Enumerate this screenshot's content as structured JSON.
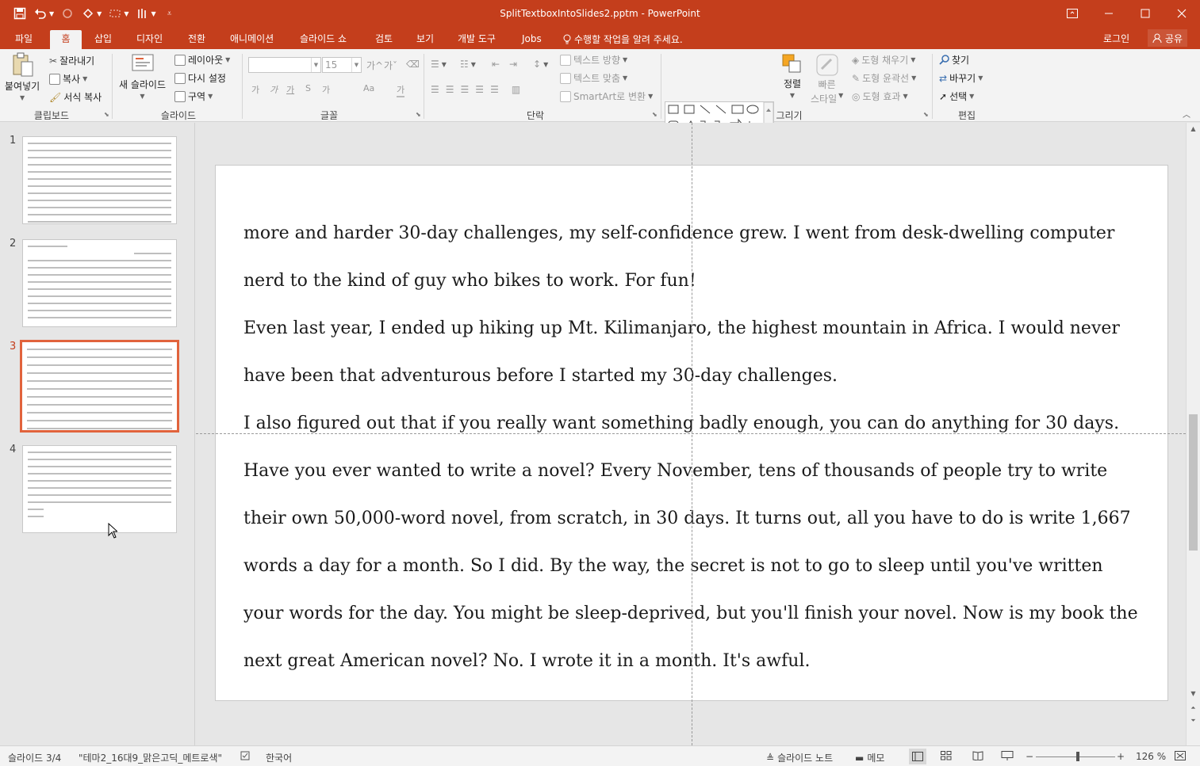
{
  "window": {
    "title": "SplitTextboxIntoSlides2.pptm - PowerPoint",
    "accent": "#c43e1c"
  },
  "qat": {
    "icons": [
      "save-icon",
      "undo-icon",
      "redo-icon",
      "slideshow-from-start-icon",
      "touch-mode-icon",
      "pen-icon",
      "customize-icon"
    ]
  },
  "tabs": [
    {
      "label": "파일"
    },
    {
      "label": "홈"
    },
    {
      "label": "삽입"
    },
    {
      "label": "디자인"
    },
    {
      "label": "전환"
    },
    {
      "label": "애니메이션"
    },
    {
      "label": "슬라이드 쇼"
    },
    {
      "label": "검토"
    },
    {
      "label": "보기"
    },
    {
      "label": "개발 도구"
    },
    {
      "label": "Jobs"
    },
    {
      "label": "수행할 작업을 알려 주세요."
    }
  ],
  "account": {
    "signin": "로그인",
    "share": "공유"
  },
  "ribbon": {
    "clipboard": {
      "label": "클립보드",
      "paste": "붙여넣기",
      "cut": "잘라내기",
      "copy": "복사",
      "format_painter": "서식 복사"
    },
    "slides": {
      "label": "슬라이드",
      "new_slide_1": "새 슬라이드",
      "layout": "레이아웃",
      "reset": "다시 설정",
      "section": "구역"
    },
    "font": {
      "label": "글꼴",
      "font_name": "",
      "font_size": "15",
      "buttons": [
        "가",
        "가",
        "가",
        "S",
        "가",
        "Aa",
        "가"
      ]
    },
    "paragraph": {
      "label": "단락",
      "text_direction": "텍스트 방향",
      "align_text": "텍스트 맞춤",
      "smartart": "SmartArt로 변환"
    },
    "drawing": {
      "label": "그리기",
      "arrange": "정렬",
      "quick_styles_1": "빠른",
      "quick_styles_2": "스타일",
      "shape_fill": "도형 채우기",
      "shape_outline": "도형 윤곽선",
      "shape_effects": "도형 효과"
    },
    "editing": {
      "label": "편집",
      "find": "찾기",
      "replace": "바꾸기",
      "select": "선택"
    }
  },
  "thumbnails": [
    {
      "number": "1"
    },
    {
      "number": "2"
    },
    {
      "number": "3"
    },
    {
      "number": "4"
    }
  ],
  "slide": {
    "paragraphs": [
      "more and harder 30-day challenges, my self-confidence grew. I went from desk-dwelling computer nerd to the kind of guy who bikes to work. For fun!",
      "Even last year, I ended up hiking up Mt. Kilimanjaro, the highest mountain in Africa. I would never have been that adventurous before I started my 30-day challenges.",
      "I also figured out that if you really want something badly enough, you can do anything for 30 days. Have you ever wanted to write a novel? Every November, tens of thousands of people try to write their own 50,000-word novel, from scratch, in 30 days. It turns out, all you have to do is write 1,667 words a day for a month. So I did. By the way, the secret is not to go to sleep until you've written your words for the day. You might be sleep-deprived, but you'll finish your novel. Now is my book the next great American novel? No. I wrote it in a month. It's awful."
    ]
  },
  "status": {
    "slide_counter": "슬라이드 3/4",
    "theme": "\"테마2_16대9_맑은고딕_메트로색\"",
    "language": "한국어",
    "notes": "슬라이드 노트",
    "comments": "메모",
    "zoom": "126 %"
  }
}
